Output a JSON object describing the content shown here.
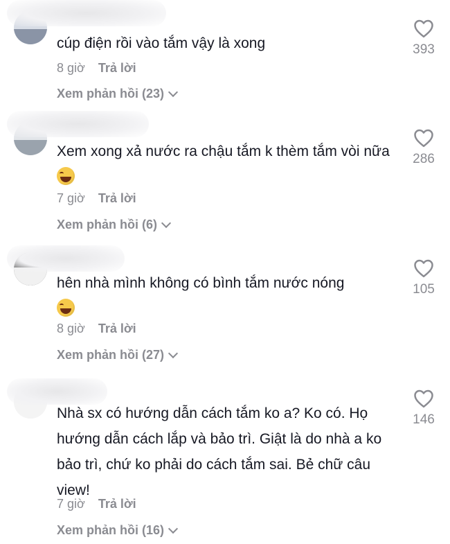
{
  "comments": [
    {
      "text": "cúp điện rồi vào tắm vậy là xong",
      "emoji": "",
      "time": "8 giờ",
      "reply": "Trả lời",
      "view_replies": "Xem phản hồi (23)",
      "likes": "393"
    },
    {
      "text": "Xem xong xả nước ra chậu tắm k thèm tắm vòi nữa",
      "emoji": "😂",
      "time": "7 giờ",
      "reply": "Trả lời",
      "view_replies": "Xem phản hồi (6)",
      "likes": "286"
    },
    {
      "text": "hên nhà mình không có bình tắm nước nóng",
      "emoji": "😂",
      "time": "8 giờ",
      "reply": "Trả lời",
      "view_replies": "Xem phản hồi (27)",
      "likes": "105"
    },
    {
      "text": "Nhà sx có hướng dẫn cách tắm ko a? Ko có. Họ hướng dẫn cách lắp và bảo trì. Giật là do nhà a ko bảo trì, chứ ko phải do cách tắm sai. Bẻ chữ câu view!",
      "emoji": "",
      "time": "7 giờ",
      "reply": "Trả lời",
      "view_replies": "Xem phản hồi (16)",
      "likes": "146"
    }
  ],
  "icons": {
    "like": "heart-outline-icon",
    "expand": "chevron-down-icon"
  },
  "colors": {
    "text": "#161823",
    "muted": "#8a8b91"
  }
}
